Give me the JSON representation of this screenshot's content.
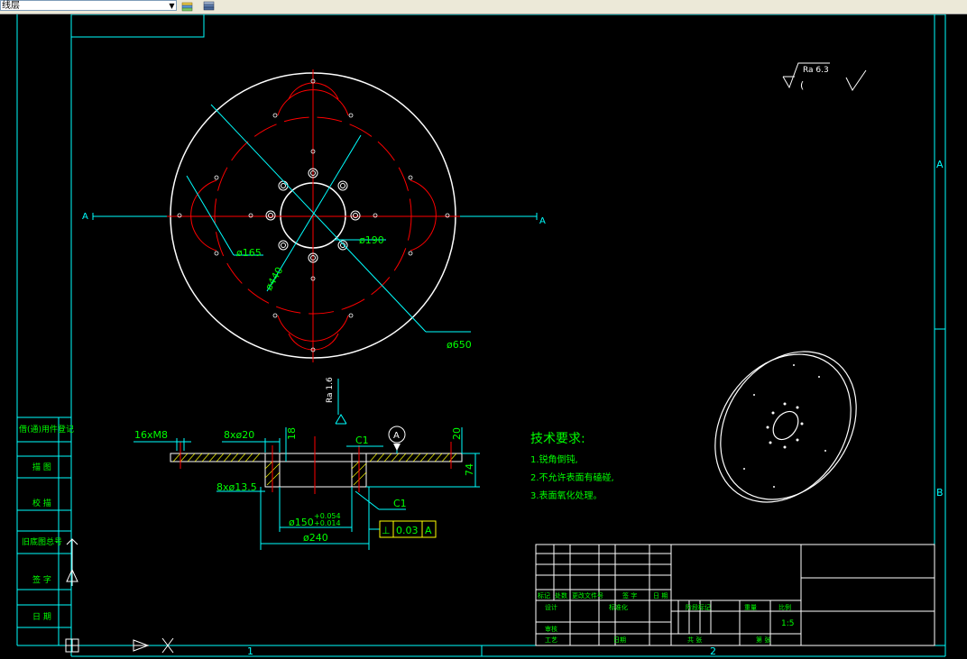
{
  "toolbar": {
    "layer_name": "线层",
    "layer_dropdown_arrow": "▼",
    "icons": [
      "layer-states-icon",
      "layer-manager-icon"
    ]
  },
  "drawing": {
    "dimensions": {
      "d165": "ø165",
      "d190": "ø190",
      "d440": "ø440",
      "d650": "ø650",
      "thread": "16xM8",
      "holes_top": "8xø20",
      "holes_bottom": "8xø13.5",
      "height18": "18",
      "height20": "20",
      "height74": "74",
      "d150": "ø150",
      "d150_tol_upper": "+0.054",
      "d150_tol_lower": "+0.014",
      "d240": "ø240",
      "chamfer1": "C1",
      "chamfer2": "C1"
    },
    "section_label_left": "A",
    "section_label_right": "A",
    "datum_label": "A",
    "tolerance_frame": {
      "symbol": "⊥",
      "value": "0.03",
      "datum": "A"
    },
    "roughness_section": "Ra 1.6",
    "roughness_top": "Ra 6.3",
    "roughness_paren": "(",
    "tech_req": {
      "title": "技术要求:",
      "items": [
        "1.锐角倒钝,",
        "2.不允许表面有磕碰,",
        "3.表面氧化处理。"
      ]
    },
    "grid_labels": {
      "right_a": "A",
      "right_b": "B",
      "bottom_1": "1",
      "bottom_2": "2"
    },
    "side_block": [
      "借(通)用件登记",
      "描 图",
      "校 描",
      "旧底图总号",
      "签 字",
      "日 期"
    ],
    "title_block": {
      "row_labels": [
        "标记",
        "处数",
        "更改文件号",
        "签 字",
        "日 期"
      ],
      "design": "设计",
      "standardize": "标准化",
      "review": "审核",
      "process": "工艺",
      "date": "日期",
      "stage_mark": "阶段标记",
      "weight": "重量",
      "scale_label": "比例",
      "scale_value": "1:5",
      "sheets_total": "共 张",
      "sheet_no": "第 张"
    }
  },
  "colors": {
    "cyan": "#00ffff",
    "red": "#ff0000",
    "green": "#00ff00",
    "white": "#ffffff",
    "yellow": "#ffff00"
  }
}
